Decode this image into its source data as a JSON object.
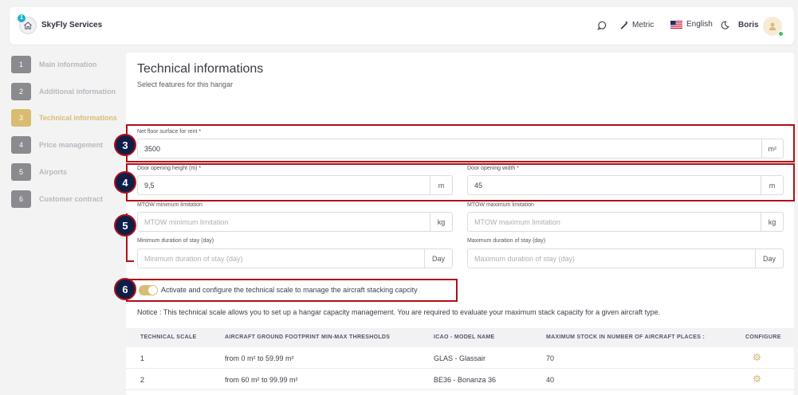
{
  "header": {
    "notification_count": "1",
    "brand": "SkyFly Services",
    "unit_system": "Metric",
    "language": "English",
    "user_name": "Boris"
  },
  "sidebar": {
    "steps": [
      {
        "number": "1",
        "label": "Main information"
      },
      {
        "number": "2",
        "label": "Additional information"
      },
      {
        "number": "3",
        "label": "Technical informations",
        "active": true
      },
      {
        "number": "4",
        "label": "Price management"
      },
      {
        "number": "5",
        "label": "Airports"
      },
      {
        "number": "6",
        "label": "Customer contract"
      }
    ]
  },
  "main": {
    "title": "Technical informations",
    "subtitle": "Select features for this hangar",
    "net_floor": {
      "label": "Net floor surface for rent *",
      "value": "3500",
      "unit": "m²"
    },
    "door_height": {
      "label": "Door opening height (m) *",
      "value": "9,5",
      "unit": "m"
    },
    "door_width": {
      "label": "Door opening width *",
      "value": "45",
      "unit": "m"
    },
    "mtow_min": {
      "label": "MTOW minimum limitation",
      "placeholder": "MTOW minimum limitation",
      "unit": "kg"
    },
    "mtow_max": {
      "label": "MTOW maximum limitation",
      "placeholder": "MTOW maximum limitation",
      "unit": "kg"
    },
    "stay_min": {
      "label": "Minimum duration of stay (day)",
      "placeholder": "Minimum duration of stay (day)",
      "unit": "Day"
    },
    "stay_max": {
      "label": "Maximum duration of stay (day)",
      "placeholder": "Maximum duration of stay (day)",
      "unit": "Day"
    },
    "toggle_label": "Activate and configure the technical scale to manage the aircraft stacking capcity",
    "toggle_on": true,
    "notice": "Notice : This technical scale allows you to set up a hangar capacity management. You are required to evaluate your maximum stack capacity for a given aircraft type."
  },
  "table": {
    "headers": [
      "TECHNICAL SCALE",
      "AIRCRAFT GROUND FOOTPRINT MIN-MAX THRESHOLDS",
      "ICAO - MODEL NAME",
      "MAXIMUM STOCK IN NUMBER OF AIRCRAFT PLACES :",
      "CONFIGURE"
    ],
    "rows": [
      {
        "scale": "1",
        "thresholds": "from 0 m² to 59.99 m²",
        "model": "GLAS - Glassair",
        "max_stock": "70"
      },
      {
        "scale": "2",
        "thresholds": "from 60 m² to 99.99 m²",
        "model": "BE36 - Bonanza 36",
        "max_stock": "40"
      }
    ]
  },
  "annotations": [
    "3",
    "4",
    "5",
    "6"
  ],
  "colors": {
    "accent": "#d9bc72",
    "annotation_red": "#b01018",
    "annotation_navy": "#0f1e47",
    "step_gray": "#8a8a8f"
  }
}
